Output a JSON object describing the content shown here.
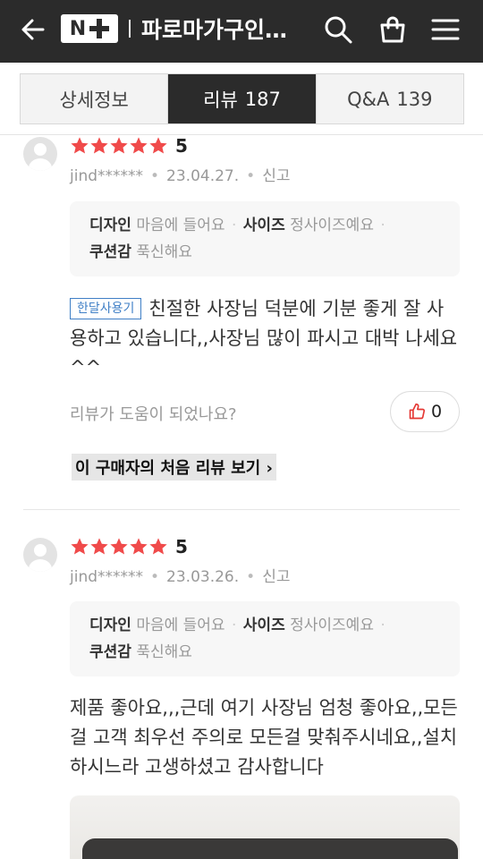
{
  "header": {
    "brand": "N+",
    "store_title": "파로마가구인…"
  },
  "tabs": [
    {
      "label": "상세정보",
      "count": ""
    },
    {
      "label": "리뷰",
      "count": "187"
    },
    {
      "label": "Q&A",
      "count": "139"
    }
  ],
  "reviews": [
    {
      "rating": "5",
      "user": "jind******",
      "date": "23.04.27.",
      "report": "신고",
      "opt_design_label": "디자인",
      "opt_design_value": "마음에 들어요",
      "opt_size_label": "사이즈",
      "opt_size_value": "정사이즈예요",
      "opt_cushion_label": "쿠션감",
      "opt_cushion_value": "푹신해요",
      "badge": "한달사용기",
      "text": "친절한 사장님 덕분에 기분 좋게 잘 사용하고 있습니다,,사장님 많이 파시고 대박 나세요^^",
      "helpful_question": "리뷰가 도움이 되었나요?",
      "likes": "0",
      "first_review_link": "이 구매자의 처음 리뷰 보기"
    },
    {
      "rating": "5",
      "user": "jind******",
      "date": "23.03.26.",
      "report": "신고",
      "opt_design_label": "디자인",
      "opt_design_value": "마음에 들어요",
      "opt_size_label": "사이즈",
      "opt_size_value": "정사이즈예요",
      "opt_cushion_label": "쿠션감",
      "opt_cushion_value": "푹신해요",
      "text": "제품 좋아요,,,근데 여기 사장님 엄청 좋아요,,모든걸 고객 최우선 주의로 모든걸 맞춰주시네요,,설치 하시느라 고생하셨고 감사합니다"
    }
  ],
  "colors": {
    "header_bg": "#2b2b2b",
    "star": "#f04a4a",
    "badge": "#3f7fc6",
    "like_icon": "#e53935"
  }
}
